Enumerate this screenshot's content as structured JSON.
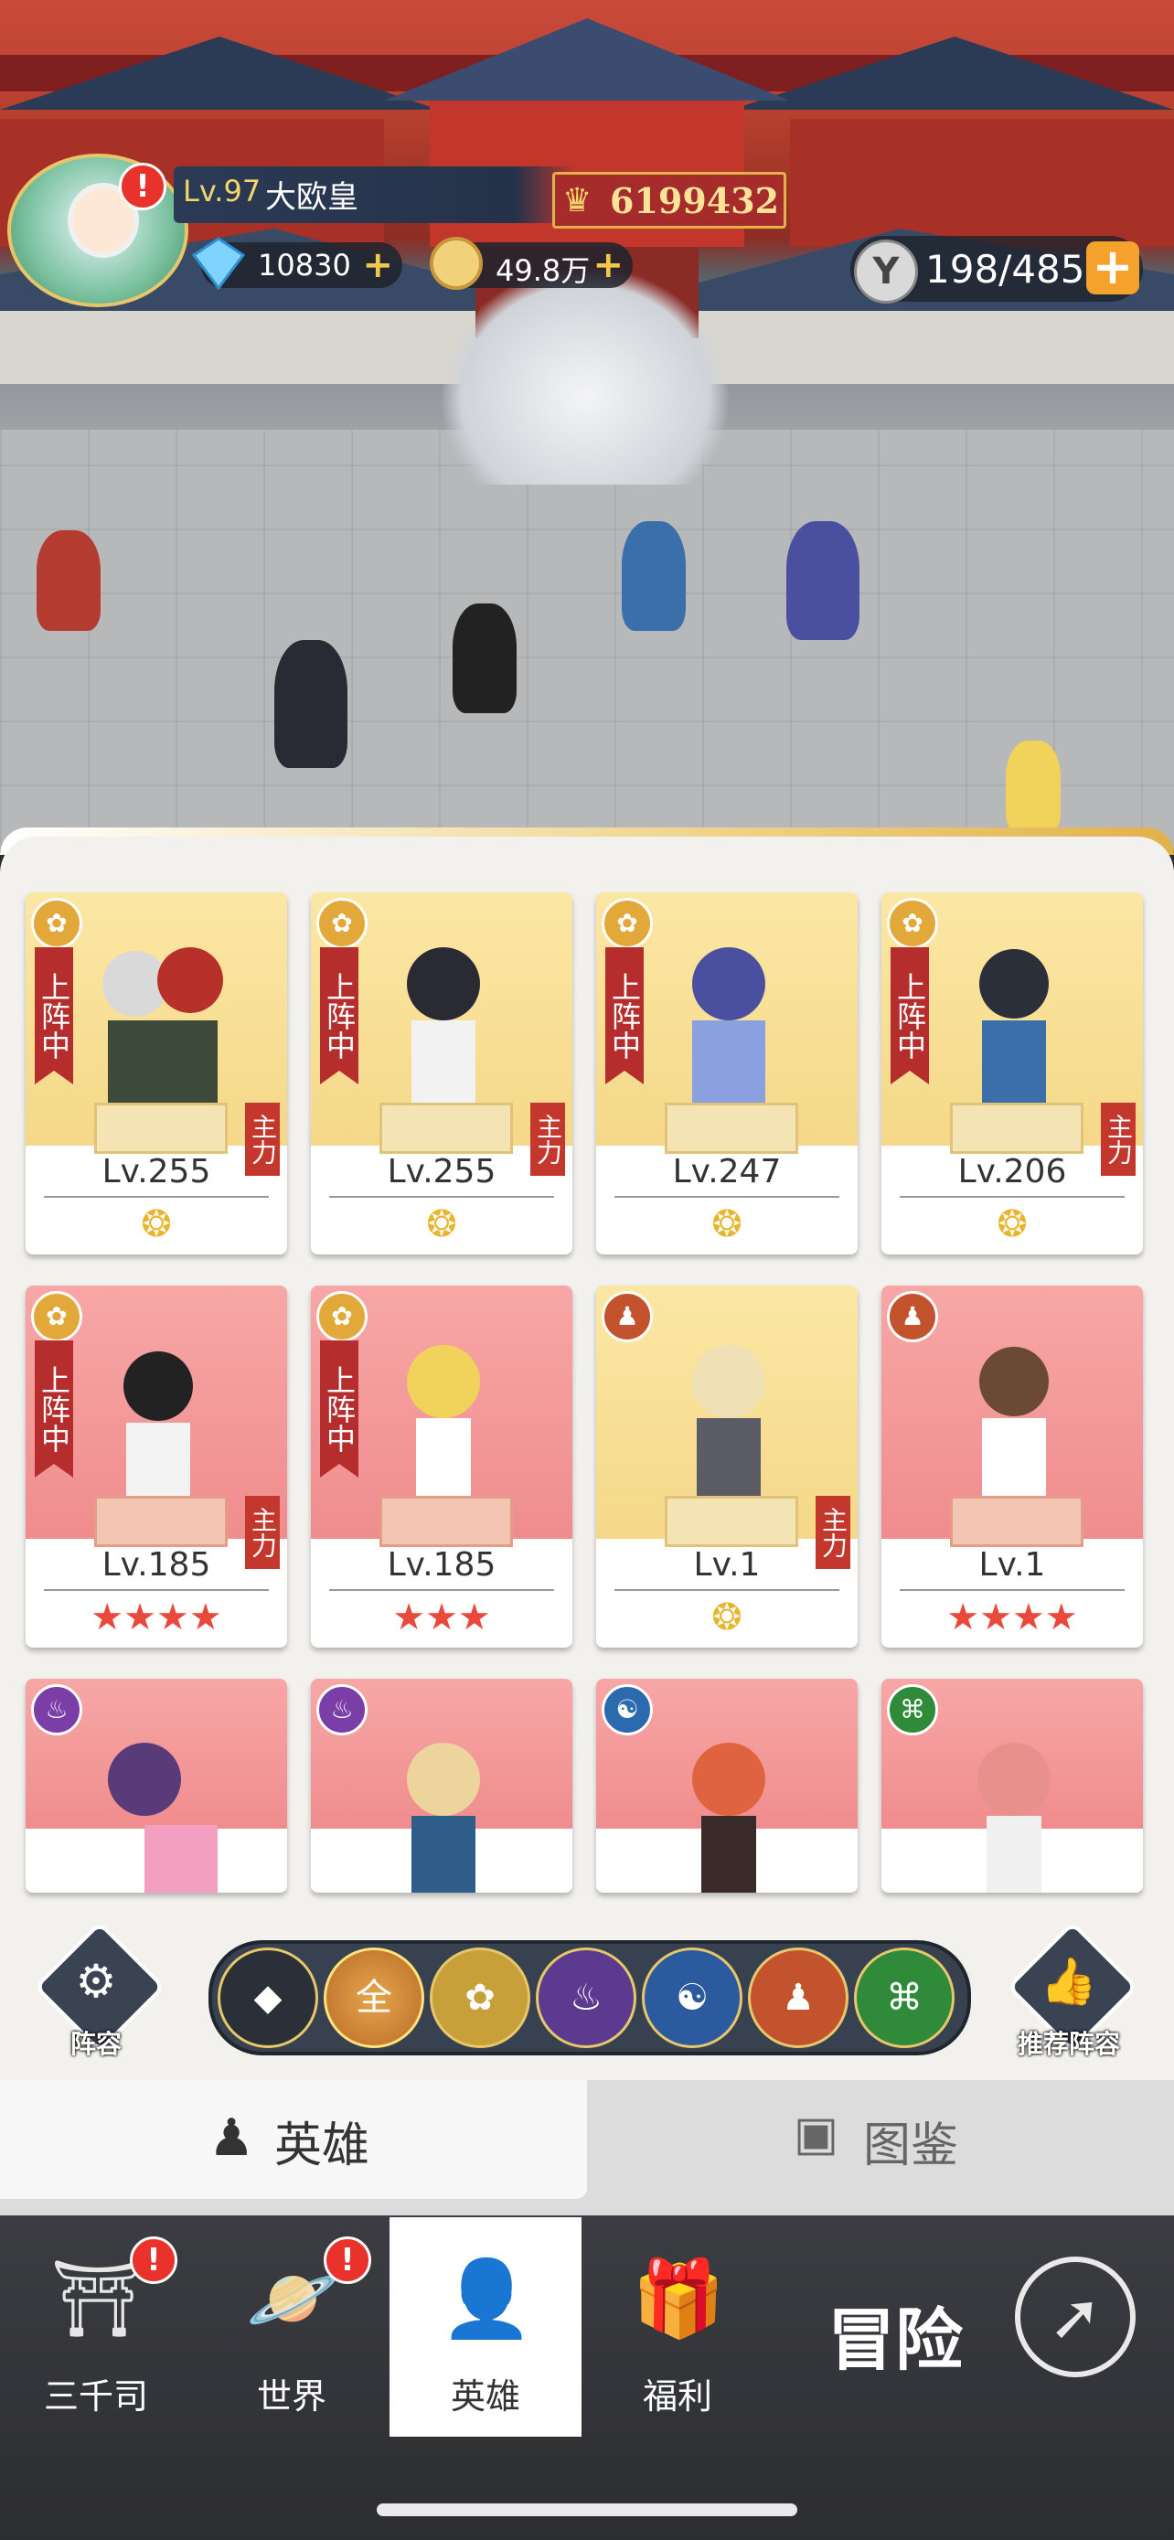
{
  "player": {
    "level": "Lv.97",
    "name": "大欧皇",
    "power": "6199432"
  },
  "resources": {
    "diamonds": "10830",
    "gold": "49.8万",
    "stamina": "198/485"
  },
  "heroes": [
    {
      "level": "Lv.255",
      "status": "上阵中",
      "tag": "主力",
      "stars": "gold",
      "bg": "gold"
    },
    {
      "level": "Lv.255",
      "status": "上阵中",
      "tag": "主力",
      "stars": "gold",
      "bg": "gold"
    },
    {
      "level": "Lv.247",
      "status": "上阵中",
      "tag": "",
      "stars": "gold",
      "bg": "gold"
    },
    {
      "level": "Lv.206",
      "status": "上阵中",
      "tag": "主力",
      "stars": "gold",
      "bg": "gold"
    },
    {
      "level": "Lv.185",
      "status": "上阵中",
      "tag": "主力",
      "stars": "★★★★",
      "bg": "red"
    },
    {
      "level": "Lv.185",
      "status": "上阵中",
      "tag": "",
      "stars": "★★★",
      "bg": "red"
    },
    {
      "level": "Lv.1",
      "status": "",
      "tag": "主力",
      "stars": "gold",
      "bg": "gold"
    },
    {
      "level": "Lv.1",
      "status": "",
      "tag": "",
      "stars": "★★★★",
      "bg": "red"
    }
  ],
  "faction_filter": {
    "all_label": "全",
    "left_button": "阵容",
    "right_button": "推荐阵容"
  },
  "tabs": {
    "heroes": "英雄",
    "codex": "图鉴"
  },
  "nav": {
    "sanqiansi": "三千司",
    "world": "世界",
    "heroes": "英雄",
    "welfare": "福利",
    "adventure": "冒险"
  }
}
